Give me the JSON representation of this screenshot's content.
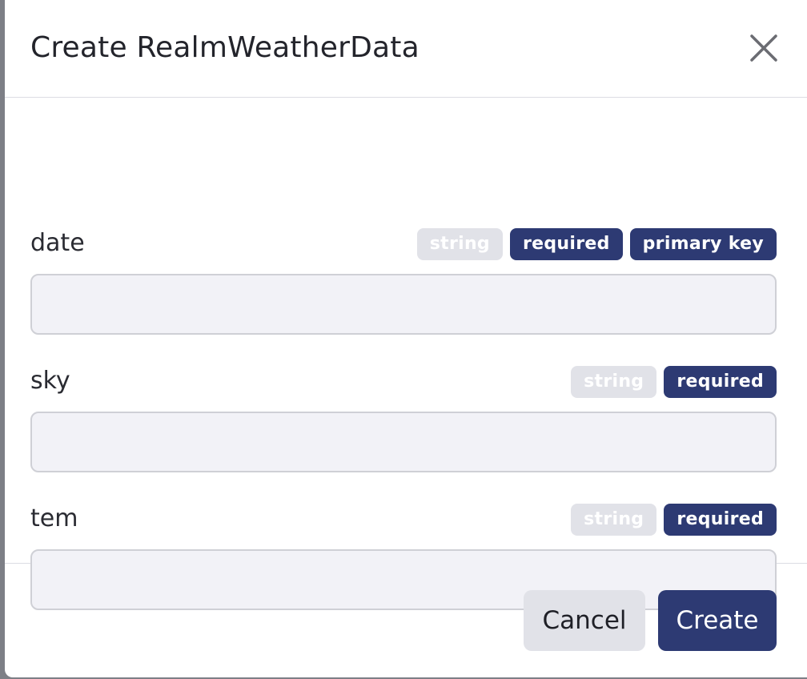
{
  "dialog": {
    "title": "Create RealmWeatherData",
    "close_icon": "close-icon"
  },
  "fields": [
    {
      "label": "date",
      "badges": [
        "string",
        "required",
        "primary key"
      ],
      "value": "",
      "placeholder": ""
    },
    {
      "label": "sky",
      "badges": [
        "string",
        "required"
      ],
      "value": "",
      "placeholder": ""
    },
    {
      "label": "tem",
      "badges": [
        "string",
        "required"
      ],
      "value": "",
      "placeholder": ""
    }
  ],
  "footer": {
    "cancel_label": "Cancel",
    "create_label": "Create"
  },
  "colors": {
    "primary": "#2d3a73",
    "badge_muted": "#e1e2e8",
    "input_bg": "#f2f2f7"
  }
}
